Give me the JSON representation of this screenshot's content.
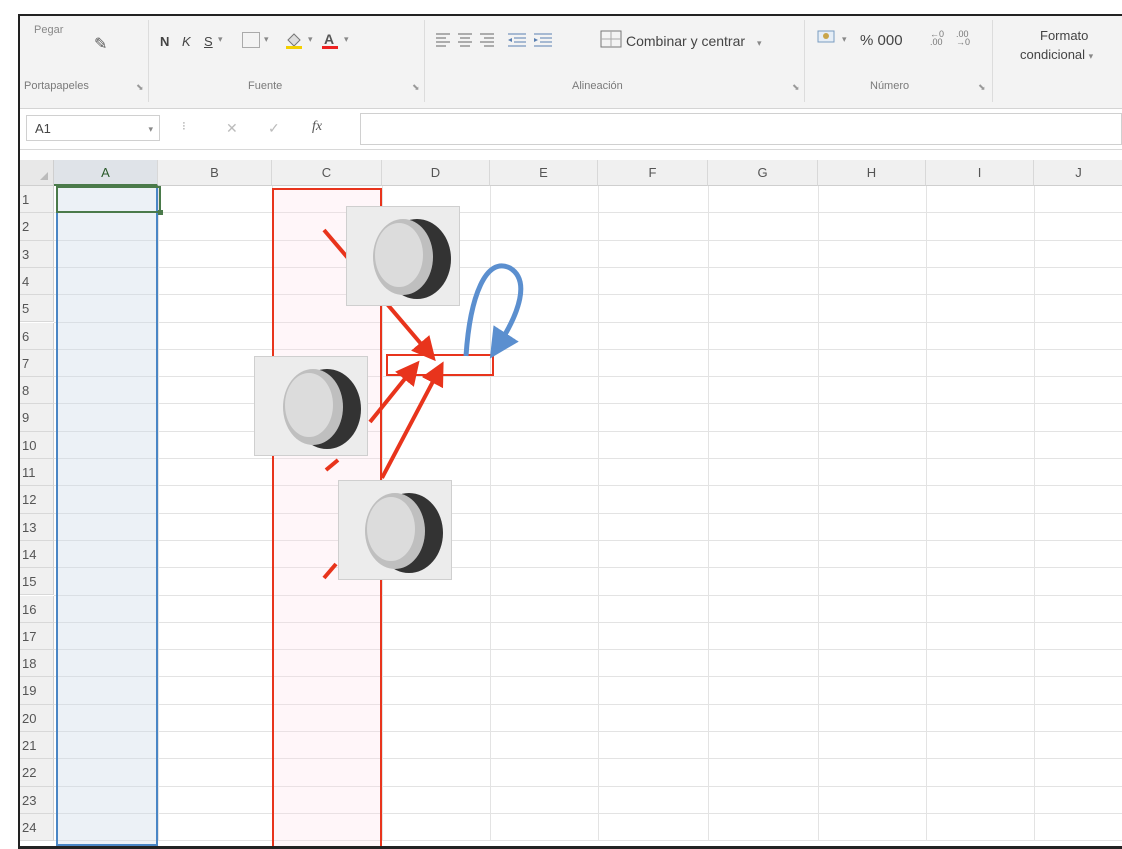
{
  "ribbon": {
    "paste_label": "Pegar",
    "bold": "N",
    "italic": "K",
    "underline": "S",
    "merge_label": "Combinar y centrar",
    "number_symbols": "% 000",
    "conditional_line1": "Formato",
    "conditional_line2": "condicional",
    "groups": {
      "clipboard": "Portapapeles",
      "font": "Fuente",
      "alignment": "Alineación",
      "number": "Número"
    }
  },
  "formula_bar": {
    "name_box": "A1",
    "fx": "fx",
    "cancel": "✕",
    "enter": "✓"
  },
  "grid": {
    "columns": [
      "A",
      "B",
      "C",
      "D",
      "E",
      "F",
      "G",
      "H",
      "I",
      "J"
    ],
    "rows": [
      "1",
      "2",
      "3",
      "4",
      "5",
      "6",
      "7",
      "8",
      "9",
      "10",
      "11",
      "12",
      "13",
      "14",
      "15",
      "16",
      "17",
      "18",
      "19",
      "20",
      "21",
      "22",
      "23",
      "24"
    ]
  },
  "colors": {
    "selected_column_highlight": "#4a86c5",
    "annotation_red": "#e8341c",
    "annotation_blue": "#5b8fcf"
  }
}
